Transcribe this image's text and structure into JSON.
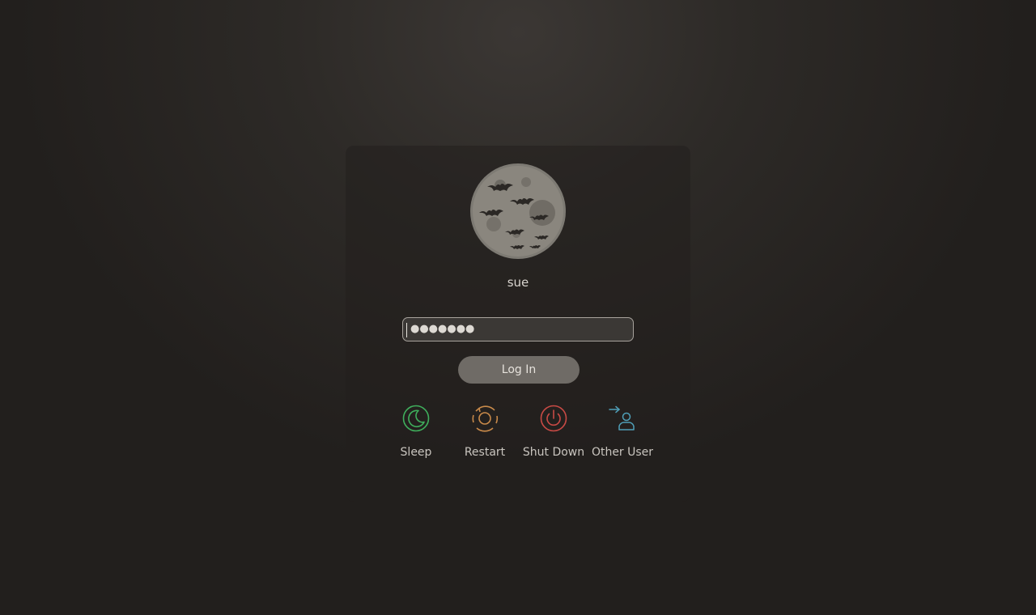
{
  "user": {
    "name": "sue",
    "avatar_icon": "bats-moon-avatar"
  },
  "password": {
    "value_masked": "●●●●●●●",
    "length": 7
  },
  "login_button": {
    "label": "Log In"
  },
  "actions": [
    {
      "label": "Sleep",
      "icon": "moon-icon",
      "color": "#3fae5c"
    },
    {
      "label": "Restart",
      "icon": "restart-icon",
      "color": "#c98a4a"
    },
    {
      "label": "Shut Down",
      "icon": "power-icon",
      "color": "#c84a45"
    },
    {
      "label": "Other User",
      "icon": "switch-user-icon",
      "color": "#4f9fb8"
    }
  ],
  "colors": {
    "panel": "#221f1d",
    "field_border": "#a8a39d",
    "button": "#6f6b66"
  }
}
